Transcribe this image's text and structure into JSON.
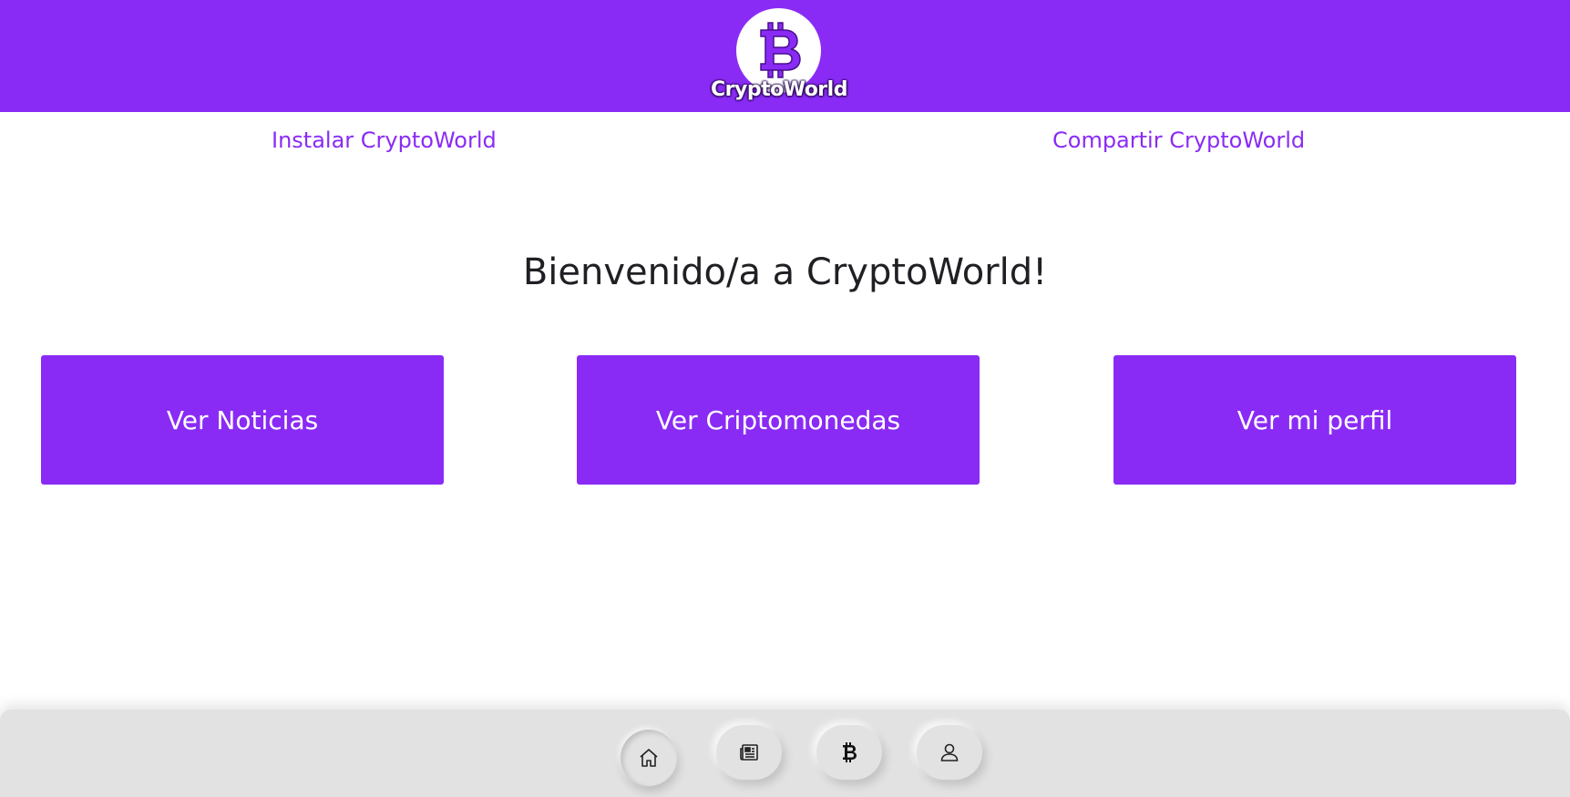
{
  "brand": {
    "name": "CryptoWorld",
    "color": "#8a2bf5"
  },
  "top_links": {
    "install": "Instalar CryptoWorld",
    "share": "Compartir CryptoWorld"
  },
  "main": {
    "title": "Bienvenido/a a CryptoWorld!",
    "buttons": [
      {
        "label": "Ver Noticias"
      },
      {
        "label": "Ver Criptomonedas"
      },
      {
        "label": "Ver mi perfil"
      }
    ]
  },
  "bottom_nav": {
    "items": [
      {
        "icon": "home-icon",
        "active": true
      },
      {
        "icon": "newspaper-icon",
        "active": false
      },
      {
        "icon": "bitcoin-icon",
        "active": false
      },
      {
        "icon": "user-icon",
        "active": false
      }
    ]
  }
}
